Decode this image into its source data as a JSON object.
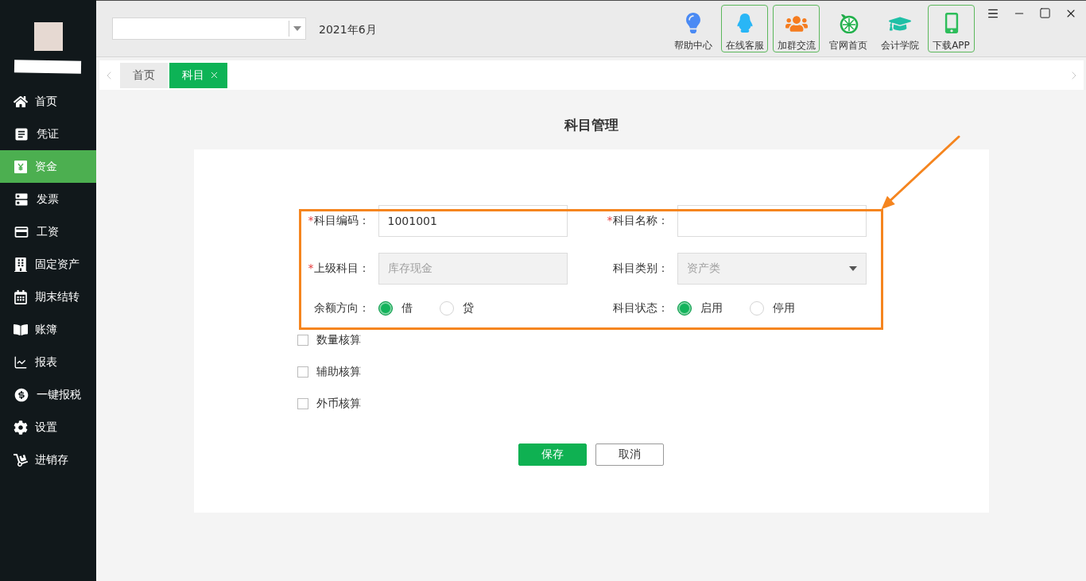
{
  "sidebar": {
    "items": [
      {
        "label": "首页",
        "selected": false
      },
      {
        "label": "凭证",
        "selected": false
      },
      {
        "label": "资金",
        "selected": true
      },
      {
        "label": "发票",
        "selected": false
      },
      {
        "label": "工资",
        "selected": false
      },
      {
        "label": "固定资产",
        "selected": false
      },
      {
        "label": "期末结转",
        "selected": false
      },
      {
        "label": "账簿",
        "selected": false
      },
      {
        "label": "报表",
        "selected": false
      },
      {
        "label": "一键报税",
        "selected": false
      },
      {
        "label": "设置",
        "selected": false
      },
      {
        "label": "进销存",
        "selected": false
      }
    ]
  },
  "topbar": {
    "period": "2021年6月",
    "shortcuts": [
      {
        "label": "帮助中心",
        "highlighted": false
      },
      {
        "label": "在线客服",
        "highlighted": true
      },
      {
        "label": "加群交流",
        "highlighted": true
      },
      {
        "label": "官网首页",
        "highlighted": false
      },
      {
        "label": "会计学院",
        "highlighted": false
      },
      {
        "label": "下载APP",
        "highlighted": true
      }
    ]
  },
  "tabs": [
    {
      "label": "首页",
      "selected": false,
      "closable": false
    },
    {
      "label": "科目",
      "selected": true,
      "closable": true
    }
  ],
  "page": {
    "title": "科目管理",
    "fields": [
      {
        "kind": "input",
        "required_mark": "*",
        "label": "科目编码：",
        "value": "1001001",
        "disabled": false
      },
      {
        "kind": "input",
        "required_mark": "*",
        "label": "科目名称：",
        "disabled": false
      },
      {
        "kind": "input",
        "required_mark": "*",
        "label": "上级科目：",
        "value": "库存现金",
        "disabled": true
      },
      {
        "kind": "select",
        "label": "科目类别：",
        "value": "资产类",
        "disabled": true
      },
      {
        "kind": "radio",
        "label": "余额方向：",
        "options": [
          {
            "label": "借",
            "selected": true
          },
          {
            "label": "贷",
            "selected": false
          }
        ]
      },
      {
        "kind": "radio",
        "label": "科目状态：",
        "options": [
          {
            "label": "启用",
            "selected": true
          },
          {
            "label": "停用",
            "selected": false
          }
        ]
      }
    ],
    "checkboxes": [
      {
        "label": "数量核算",
        "checked": false
      },
      {
        "label": "辅助核算",
        "checked": false
      },
      {
        "label": "外币核算",
        "checked": false
      }
    ],
    "buttons": [
      {
        "label": "保存",
        "kind": "primary"
      },
      {
        "label": "取消",
        "kind": "default"
      }
    ]
  }
}
